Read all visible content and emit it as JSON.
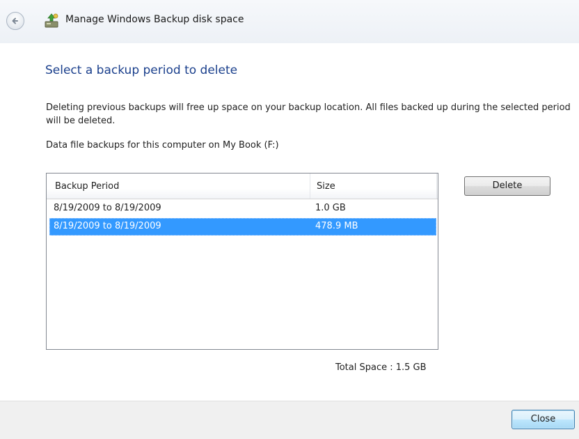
{
  "window": {
    "title": "Manage Windows Backup disk space"
  },
  "page": {
    "heading": "Select a backup period to delete",
    "description": "Deleting previous backups will free up space on your backup location. All files backed up during the selected period will be deleted.",
    "subheading": "Data file backups for this computer on My Book (F:)"
  },
  "list": {
    "columns": [
      "Backup Period",
      "Size"
    ],
    "rows": [
      {
        "period": "8/19/2009 to 8/19/2009",
        "size": "1.0 GB",
        "selected": false
      },
      {
        "period": "8/19/2009 to 8/19/2009",
        "size": "478.9 MB",
        "selected": true
      }
    ],
    "selection_color": "#3399ff"
  },
  "buttons": {
    "delete_label": "Delete",
    "close_label": "Close"
  },
  "total": {
    "label": "Total Space : 1.5 GB"
  },
  "icons": {
    "back": "back-arrow-icon",
    "app": "windows-backup-icon"
  },
  "colors": {
    "heading": "#1a3f8c",
    "footer_bg": "#f0f0f0"
  }
}
